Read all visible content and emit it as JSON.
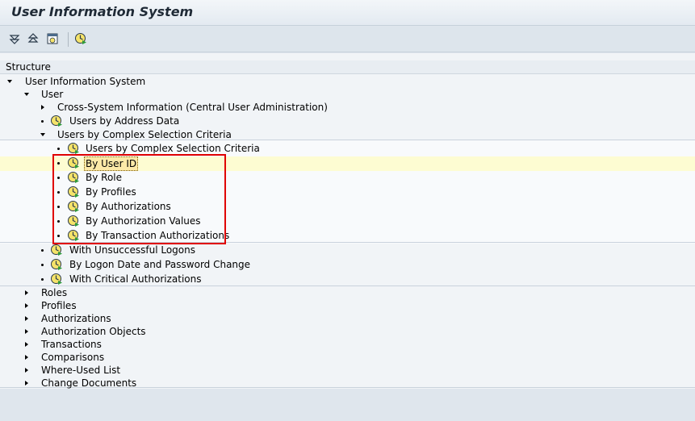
{
  "app": {
    "title": "User Information System"
  },
  "toolbar": {
    "buttons": [
      {
        "icon": "expand-all-icon"
      },
      {
        "icon": "collapse-all-icon"
      },
      {
        "icon": "execute-in-window-icon"
      },
      {
        "icon": "execute-icon"
      }
    ]
  },
  "tree": {
    "header": "Structure",
    "root": "User Information System",
    "user": "User",
    "cross_system": "Cross-System Information (Central User Administration)",
    "by_address": "Users by Address Data",
    "complex": "Users by Complex Selection Criteria",
    "complex_items": [
      "Users by Complex Selection Criteria",
      "By User ID",
      "By Role",
      "By Profiles",
      "By Authorizations",
      "By Authorization Values",
      "By Transaction Authorizations"
    ],
    "user_more": [
      "With Unsuccessful Logons",
      "By Logon Date and Password Change",
      "With Critical Authorizations"
    ],
    "top_nodes": [
      "Roles",
      "Profiles",
      "Authorizations",
      "Authorization Objects",
      "Transactions",
      "Comparisons",
      "Where-Used List",
      "Change Documents"
    ]
  },
  "colors": {
    "highlight_row": "#fdfcd2",
    "annotation_box": "#e00000",
    "title_text": "#1f2a36"
  }
}
